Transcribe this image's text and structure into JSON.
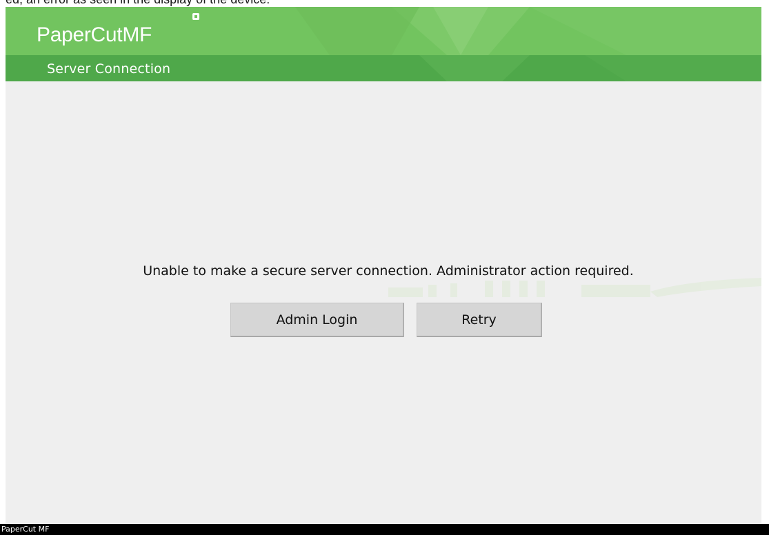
{
  "caption": "ed, an error as seen in the display of the device:",
  "header": {
    "brand": "PaperCut",
    "brand_suffix": "MF",
    "title": "Server Connection"
  },
  "main": {
    "message": "Unable to make a secure server connection. Administrator action required.",
    "buttons": {
      "admin_login": "Admin Login",
      "retry": "Retry"
    }
  },
  "footer": {
    "label": "PaperCut MF"
  },
  "colors": {
    "header_green": "#6cbf5a",
    "header_band": "#4ea84a",
    "background": "#efefef",
    "button": "#d6d6d6",
    "footer": "#000000"
  }
}
